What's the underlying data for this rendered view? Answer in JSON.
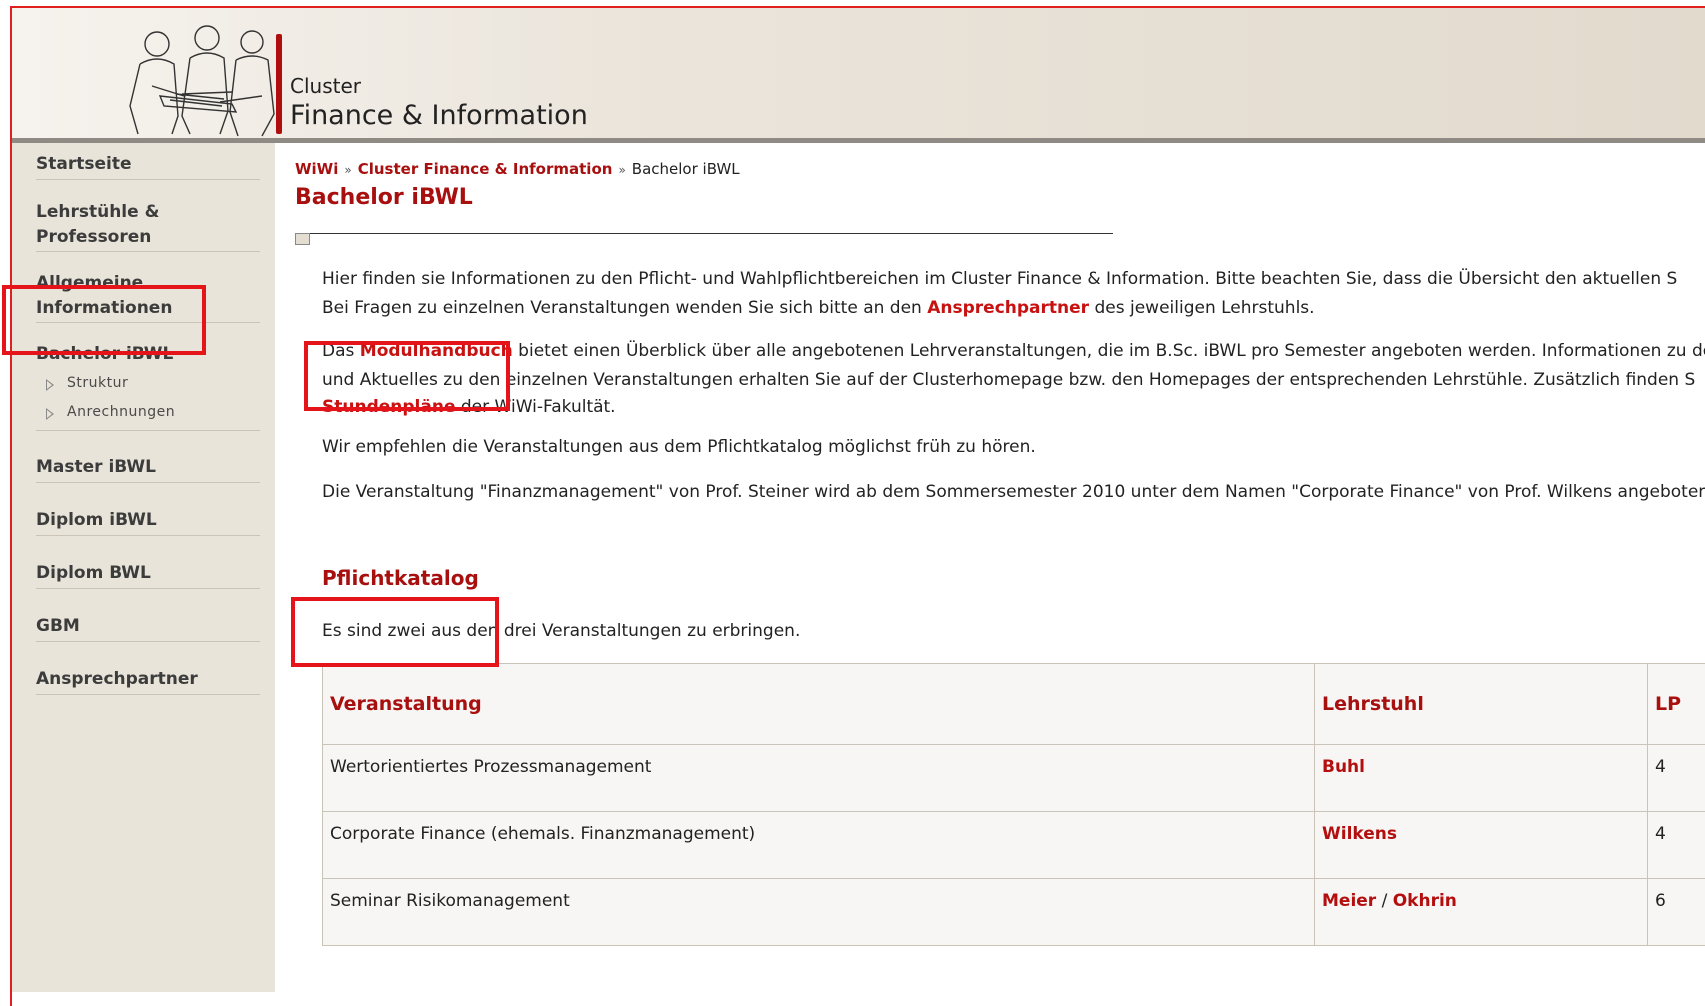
{
  "header": {
    "small_title": "Cluster",
    "big_title": "Finance & Information"
  },
  "sidebar": {
    "items": [
      {
        "label": "Startseite"
      },
      {
        "label": "Lehrstühle &\nProfessoren"
      },
      {
        "label": "Allgemeine\nInformationen"
      },
      {
        "label": "Bachelor iBWL"
      },
      {
        "label": "Master iBWL"
      },
      {
        "label": "Diplom iBWL"
      },
      {
        "label": "Diplom BWL"
      },
      {
        "label": "GBM"
      },
      {
        "label": "Ansprechpartner"
      }
    ],
    "subitems": [
      {
        "label": "Struktur"
      },
      {
        "label": "Anrechnungen"
      }
    ]
  },
  "breadcrumb": {
    "items": [
      "WiWi",
      "Cluster Finance & Information"
    ],
    "current": "Bachelor iBWL",
    "separator": "»"
  },
  "page_title": "Bachelor iBWL",
  "intro": {
    "p1_line1": "Hier finden sie Informationen zu den Pflicht- und Wahlpflichtbereichen im Cluster Finance & Information. Bitte beachten Sie, dass die Übersicht den aktuellen S",
    "p1_line2_before": "Bei Fragen zu einzelnen Veranstaltungen wenden Sie sich bitte an den ",
    "p1_line2_link": "Ansprechpartner",
    "p1_line2_after": " des jeweiligen Lehrstuhls.",
    "p2_line1_before": "Das ",
    "p2_line1_link": "Modulhandbuch",
    "p2_line1_after": " bietet einen Überblick über alle angebotenen Lehrveranstaltungen, die im B.Sc. iBWL pro Semester angeboten werden. Informationen zu de",
    "p2_line2": "und Aktuelles zu den einzelnen Veranstaltungen erhalten Sie auf der Clusterhomepage bzw. den Homepages der entsprechenden Lehrstühle. Zusätzlich finden S",
    "p2_line3_link": "Stundenpläne",
    "p2_line3_after": " der WiWi-Fakultät.",
    "p3": "Wir empfehlen die Veranstaltungen aus dem Pflichtkatalog möglichst früh zu hören.",
    "p4": "Die Veranstaltung \"Finanzmanagement\" von Prof. Steiner wird ab dem Sommersemester 2010 unter dem Namen \"Corporate Finance\" von Prof. Wilkens angeboten"
  },
  "pflicht": {
    "heading": "Pflichtkatalog",
    "note": "Es sind zwei aus den drei Veranstaltungen zu erbringen.",
    "columns": [
      "Veranstaltung",
      "Lehrstuhl",
      "LP"
    ],
    "rows": [
      {
        "course": "Wertorientiertes Prozessmanagement",
        "chairs": [
          "Buhl"
        ],
        "lp": "4"
      },
      {
        "course": "Corporate Finance (ehemals. Finanzmanagement)",
        "chairs": [
          "Wilkens"
        ],
        "lp": "4"
      },
      {
        "course": "Seminar Risikomanagement",
        "chairs": [
          "Meier",
          "Okhrin"
        ],
        "lp": "6"
      }
    ]
  },
  "colors": {
    "accent_red": "#a80f0f",
    "link_red": "#c81111",
    "sidebar_bg": "#e9e4d9",
    "highlight_box": "#e5141b"
  }
}
